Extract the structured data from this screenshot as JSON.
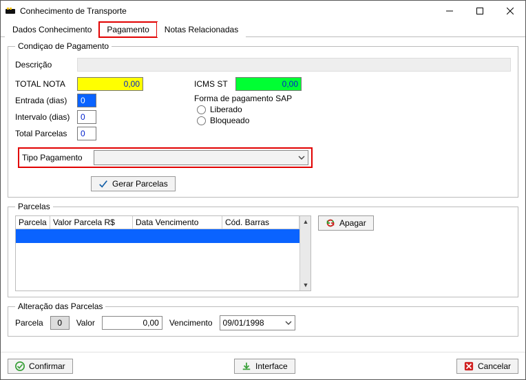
{
  "window": {
    "title": "Conhecimento de Transporte"
  },
  "tabs": {
    "dados": "Dados Conhecimento",
    "pagamento": "Pagamento",
    "notas": "Notas Relacionadas"
  },
  "condicao": {
    "legend": "Condiçao de Pagamento",
    "descricao_label": "Descrição",
    "descricao_value": "",
    "total_nota_label": "TOTAL NOTA",
    "total_nota_value": "0,00",
    "icms_label": "ICMS ST",
    "icms_value": "0,00",
    "entrada_label": "Entrada (dias)",
    "entrada_value": "0",
    "intervalo_label": "Intervalo (dias)",
    "intervalo_value": "0",
    "total_parcelas_label": "Total Parcelas",
    "total_parcelas_value": "0",
    "forma_sap_label": "Forma de pagamento SAP",
    "forma_sap_opts": {
      "liberado": "Liberado",
      "bloqueado": "Bloqueado"
    },
    "tipo_label": "Tipo Pagamento",
    "tipo_value": "",
    "gerar_btn": "Gerar Parcelas"
  },
  "parcelas": {
    "legend": "Parcelas",
    "cols": {
      "c1": "Parcela",
      "c2": "Valor Parcela R$",
      "c3": "Data Vencimento",
      "c4": "Cód. Barras"
    },
    "apagar_btn": "Apagar"
  },
  "alteracao": {
    "legend": "Alteração das Parcelas",
    "parcela_label": "Parcela",
    "parcela_value": "0",
    "valor_label": "Valor",
    "valor_value": "0,00",
    "venc_label": "Vencimento",
    "venc_value": "09/01/1998"
  },
  "footer": {
    "confirmar": "Confirmar",
    "interface": "Interface",
    "cancelar": "Cancelar"
  }
}
